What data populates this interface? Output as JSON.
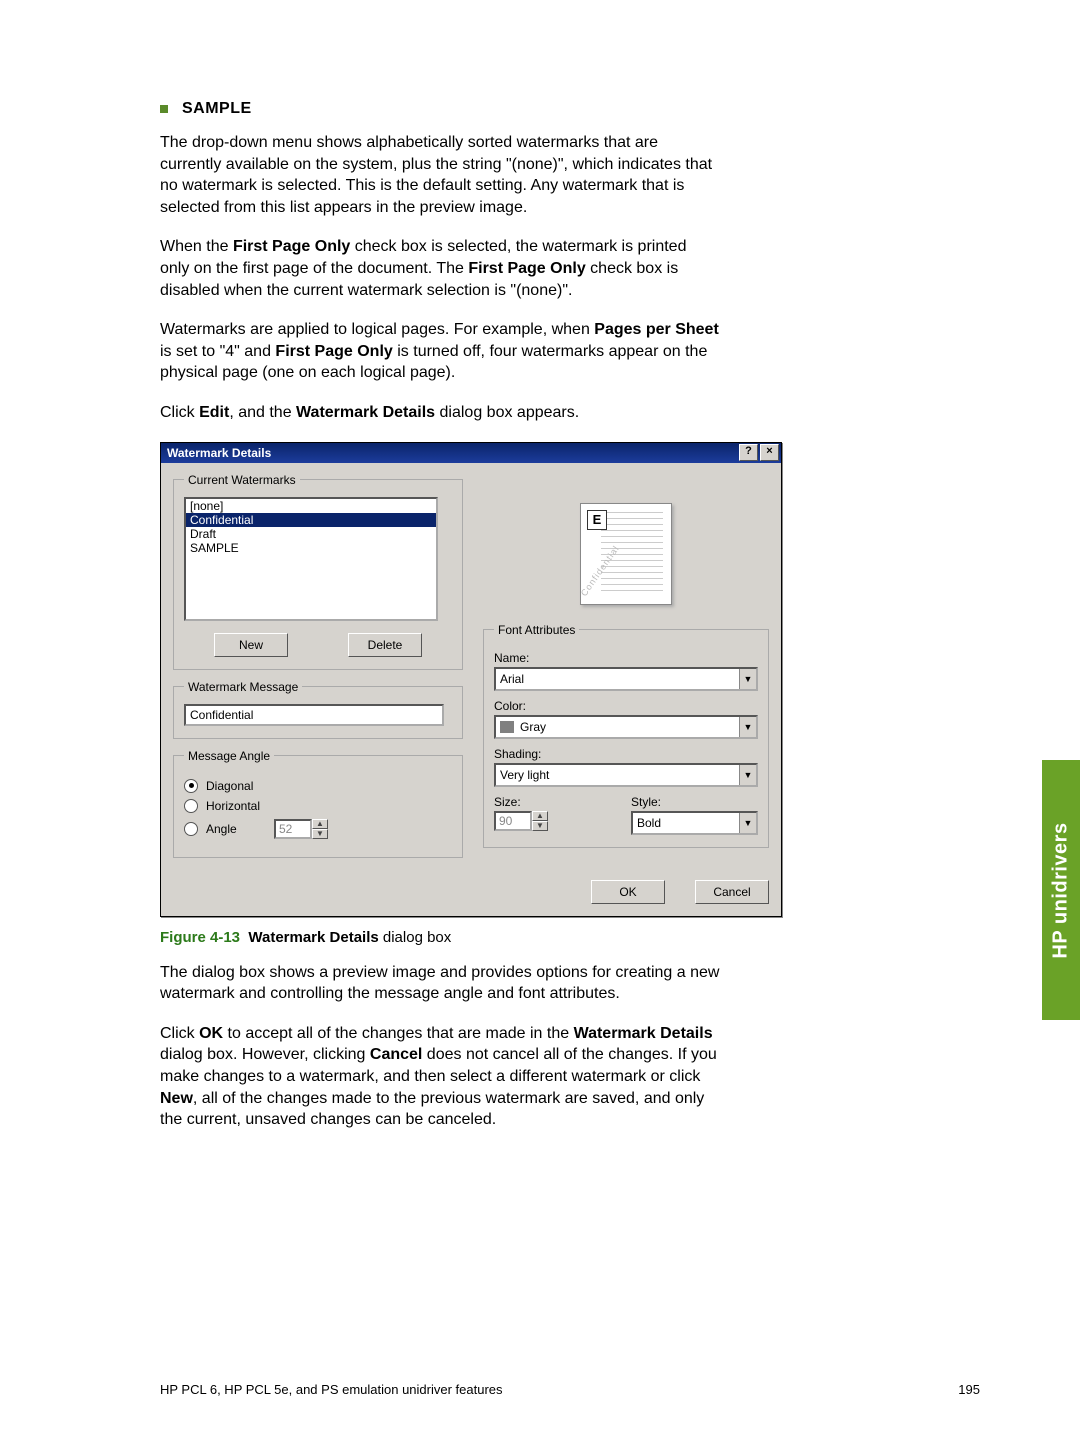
{
  "bullet_heading": "SAMPLE",
  "paras": {
    "p1": "The drop-down menu shows alphabetically sorted watermarks that are currently available on the system, plus the string \"(none)\", which indicates that no watermark is selected. This is the default setting. Any watermark that is selected from this list appears in the preview image.",
    "p2a": "When the ",
    "p2b": "First Page Only",
    "p2c": " check box is selected, the watermark is printed only on the first page of the document. The ",
    "p2d": "First Page Only",
    "p2e": " check box is disabled when the current watermark selection is \"(none)\".",
    "p3a": "Watermarks are applied to logical pages. For example, when ",
    "p3b": "Pages per Sheet",
    "p3c": " is set to \"4\" and ",
    "p3d": "First Page Only",
    "p3e": " is turned off, four watermarks appear on the physical page (one on each logical page).",
    "p4a": "Click ",
    "p4b": "Edit",
    "p4c": ", and the ",
    "p4d": "Watermark Details",
    "p4e": " dialog box appears.",
    "p5": "The dialog box shows a preview image and provides options for creating a new watermark and controlling the message angle and font attributes.",
    "p6a": "Click ",
    "p6b": "OK",
    "p6c": " to accept all of the changes that are made in the ",
    "p6d": "Watermark Details",
    "p6e": " dialog box. However, clicking ",
    "p6f": "Cancel",
    "p6g": " does not cancel all of the changes. If you make changes to a watermark, and then select a different watermark or click ",
    "p6h": "New",
    "p6i": ", all of the changes made to the previous watermark are saved, and only the current, unsaved changes can be canceled."
  },
  "dialog": {
    "title": "Watermark Details",
    "help_glyph": "?",
    "close_glyph": "×",
    "current_legend": "Current Watermarks",
    "list": {
      "i0": "[none]",
      "i1": "Confidential",
      "i2": "Draft",
      "i3": "SAMPLE"
    },
    "new_btn": "New",
    "delete_btn": "Delete",
    "msg_legend": "Watermark Message",
    "msg_value": "Confidential",
    "angle_legend": "Message Angle",
    "angle_diagonal": "Diagonal",
    "angle_horizontal": "Horizontal",
    "angle_angle": "Angle",
    "angle_value": "52",
    "preview_glyph": "E",
    "preview_diag": "Confidential",
    "font_legend": "Font Attributes",
    "name_label": "Name:",
    "name_value": "Arial",
    "color_label": "Color:",
    "color_value": "Gray",
    "shading_label": "Shading:",
    "shading_value": "Very light",
    "size_label": "Size:",
    "size_value": "90",
    "style_label": "Style:",
    "style_value": "Bold",
    "ok": "OK",
    "cancel": "Cancel"
  },
  "caption": {
    "num": "Figure 4-13",
    "bold": "Watermark Details",
    "rest": " dialog box"
  },
  "side_tab": "HP unidrivers",
  "footer_left": "HP PCL 6, HP PCL 5e, and PS emulation unidriver features",
  "footer_right": "195"
}
